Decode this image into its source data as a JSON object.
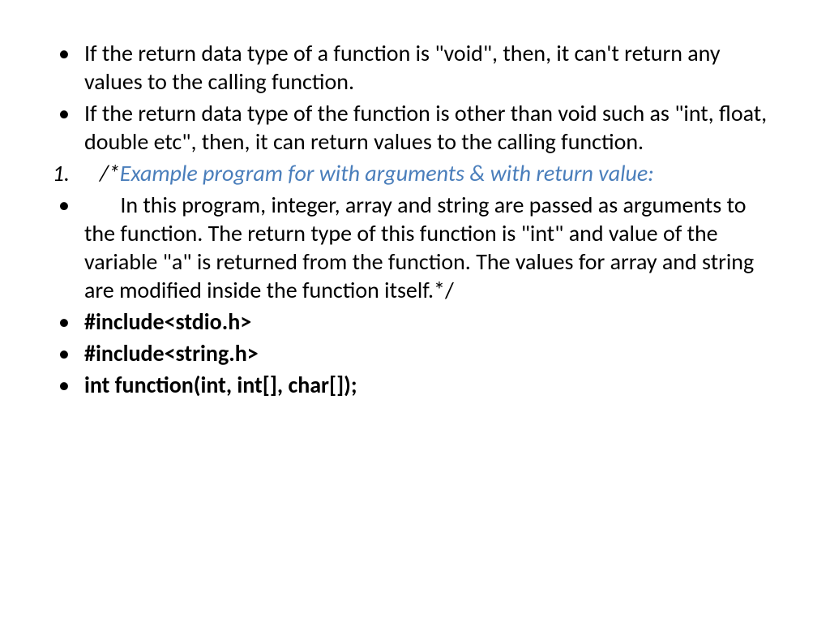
{
  "slide": {
    "items": [
      {
        "type": "bullet",
        "segments": [
          {
            "text": "If the return data type of a function is \"void\", then, it can't return any values to the calling function.",
            "style": "normal"
          }
        ]
      },
      {
        "type": "bullet",
        "segments": [
          {
            "text": "If the return data type of the function is other than void such as \"int, float, double etc\", then, it can return values to the calling function.",
            "style": "normal"
          }
        ]
      },
      {
        "type": "numbered",
        "marker": "1.",
        "segments": [
          {
            "text": "   /*",
            "style": "italic"
          },
          {
            "text": "Example program for with arguments & with return value:",
            "style": "italic-blue"
          }
        ]
      },
      {
        "type": "bullet",
        "segments": [
          {
            "text": "       In this program, integer, array and string are passed as arguments to the function. The return type of this function is \"int\" and value of the variable \"a\" is returned from the function. The values for array and string are modified inside the function itself.*/",
            "style": "normal"
          }
        ]
      },
      {
        "type": "bullet",
        "segments": [
          {
            "text": "#include<stdio.h>",
            "style": "bold"
          }
        ]
      },
      {
        "type": "bullet",
        "segments": [
          {
            "text": "#include<string.h>",
            "style": "bold"
          }
        ]
      },
      {
        "type": "bullet",
        "segments": [
          {
            "text": "int function(int, int[], char[]);",
            "style": "bold"
          }
        ]
      }
    ]
  }
}
